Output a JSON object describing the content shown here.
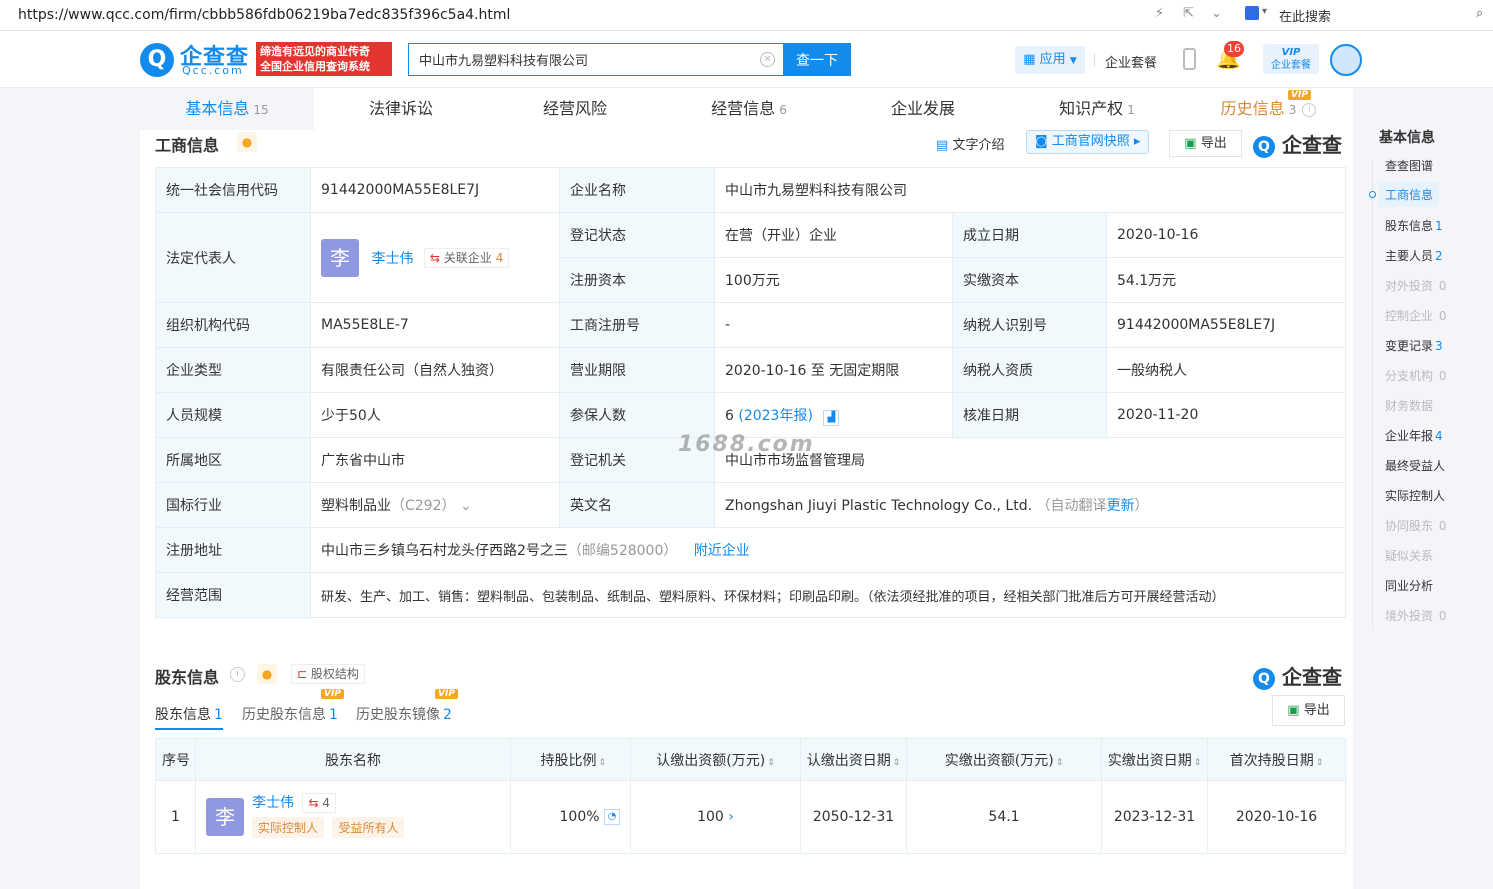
{
  "browser": {
    "url": "https://www.qcc.com/firm/cbbb586fdb06219ba7edc835f396c5a4.html",
    "search_placeholder": "在此搜索"
  },
  "header": {
    "logo_text": "企查查",
    "logo_sub": "Qcc.com",
    "slogan_line1": "缔造有远见的商业传奇",
    "slogan_line2": "全国企业信用查询系统",
    "search_value": "中山市九易塑料科技有限公司",
    "search_button": "查一下",
    "app_label": "应用",
    "plan_label": "企业套餐",
    "notify_count": "16",
    "vip_line1": "VIP",
    "vip_line2": "企业套餐"
  },
  "tabs": [
    {
      "label": "基本信息",
      "count": "15"
    },
    {
      "label": "法律诉讼",
      "count": ""
    },
    {
      "label": "经营风险",
      "count": ""
    },
    {
      "label": "经营信息",
      "count": "6"
    },
    {
      "label": "企业发展",
      "count": ""
    },
    {
      "label": "知识产权",
      "count": "1"
    },
    {
      "label": "历史信息",
      "count": "3"
    }
  ],
  "business": {
    "title": "工商信息",
    "text_intro": "文字介绍",
    "snapshot": "工商官网快照",
    "export": "导出",
    "watermark_logo": "企查查",
    "rows": {
      "credit_code_label": "统一社会信用代码",
      "credit_code": "91442000MA55E8LE7J",
      "company_name_label": "企业名称",
      "company_name": "中山市九易塑料科技有限公司",
      "legal_rep_label": "法定代表人",
      "legal_rep_avatar": "李",
      "legal_rep": "李士伟",
      "related_label": "关联企业",
      "related_count": "4",
      "reg_status_label": "登记状态",
      "reg_status": "在营（开业）企业",
      "est_date_label": "成立日期",
      "est_date": "2020-10-16",
      "reg_capital_label": "注册资本",
      "reg_capital": "100万元",
      "paid_capital_label": "实缴资本",
      "paid_capital": "54.1万元",
      "org_code_label": "组织机构代码",
      "org_code": "MA55E8LE-7",
      "reg_no_label": "工商注册号",
      "reg_no": "-",
      "taxpayer_id_label": "纳税人识别号",
      "taxpayer_id": "91442000MA55E8LE7J",
      "company_type_label": "企业类型",
      "company_type": "有限责任公司（自然人独资）",
      "term_label": "营业期限",
      "term": "2020-10-16 至 无固定期限",
      "taxpayer_qual_label": "纳税人资质",
      "taxpayer_qual": "一般纳税人",
      "staff_label": "人员规模",
      "staff": "少于50人",
      "insured_label": "参保人数",
      "insured": "6",
      "insured_year": "(2023年报)",
      "approve_label": "核准日期",
      "approve_date": "2020-11-20",
      "region_label": "所属地区",
      "region": "广东省中山市",
      "authority_label": "登记机关",
      "authority": "中山市市场监督管理局",
      "industry_label": "国标行业",
      "industry": "塑料制品业",
      "industry_code": "（C292）",
      "en_name_label": "英文名",
      "en_name": "Zhongshan Jiuyi Plastic Technology Co., Ltd.",
      "auto_translate": "（自动翻译",
      "update_link": "更新",
      "auto_translate_end": "）",
      "address_label": "注册地址",
      "address": "中山市三乡镇乌石村龙头仔西路2号之三",
      "postcode": "（邮编528000）",
      "nearby": "附近企业",
      "scope_label": "经营范围",
      "scope": "研发、生产、加工、销售：塑料制品、包装制品、纸制品、塑料原料、环保材料；印刷品印刷。（依法须经批准的项目，经相关部门批准后方可开展经营活动）"
    },
    "watermark": "1688.com"
  },
  "shareholders": {
    "title": "股东信息",
    "structure": "股权结构",
    "watermark_logo": "企查查",
    "export": "导出",
    "subtabs": [
      {
        "label": "股东信息",
        "count": "1"
      },
      {
        "label": "历史股东信息",
        "count": "1"
      },
      {
        "label": "历史股东镜像",
        "count": "2"
      }
    ],
    "headers": [
      "序号",
      "股东名称",
      "持股比例",
      "认缴出资额(万元)",
      "认缴出资日期",
      "实缴出资额(万元)",
      "实缴出资日期",
      "首次持股日期"
    ],
    "rows": [
      {
        "index": "1",
        "avatar": "李",
        "name": "李士伟",
        "related": "4",
        "tag1": "实际控制人",
        "tag2": "受益所有人",
        "ratio": "100%",
        "subscribed": "100",
        "subscribed_date": "2050-12-31",
        "paid": "54.1",
        "paid_date": "2023-12-31",
        "first_date": "2020-10-16"
      }
    ]
  },
  "right_nav": {
    "title": "基本信息",
    "items": [
      {
        "label": "查查图谱",
        "count": "",
        "disabled": false
      },
      {
        "label": "工商信息",
        "count": "",
        "disabled": false
      },
      {
        "label": "股东信息",
        "count": "1",
        "disabled": false
      },
      {
        "label": "主要人员",
        "count": "2",
        "disabled": false
      },
      {
        "label": "对外投资",
        "count": "0",
        "disabled": true
      },
      {
        "label": "控制企业",
        "count": "0",
        "disabled": true
      },
      {
        "label": "变更记录",
        "count": "3",
        "disabled": false
      },
      {
        "label": "分支机构",
        "count": "0",
        "disabled": true
      },
      {
        "label": "财务数据",
        "count": "",
        "disabled": true
      },
      {
        "label": "企业年报",
        "count": "4",
        "disabled": false
      },
      {
        "label": "最终受益人",
        "count": "",
        "disabled": false
      },
      {
        "label": "实际控制人",
        "count": "",
        "disabled": false
      },
      {
        "label": "协同股东",
        "count": "0",
        "disabled": true
      },
      {
        "label": "疑似关系",
        "count": "",
        "disabled": true
      },
      {
        "label": "同业分析",
        "count": "",
        "disabled": false
      },
      {
        "label": "境外投资",
        "count": "0",
        "disabled": true
      }
    ]
  },
  "colors": {
    "brand": "#128bed",
    "label_bg": "#f2f9fc",
    "tag_orange": "#d98a38"
  }
}
